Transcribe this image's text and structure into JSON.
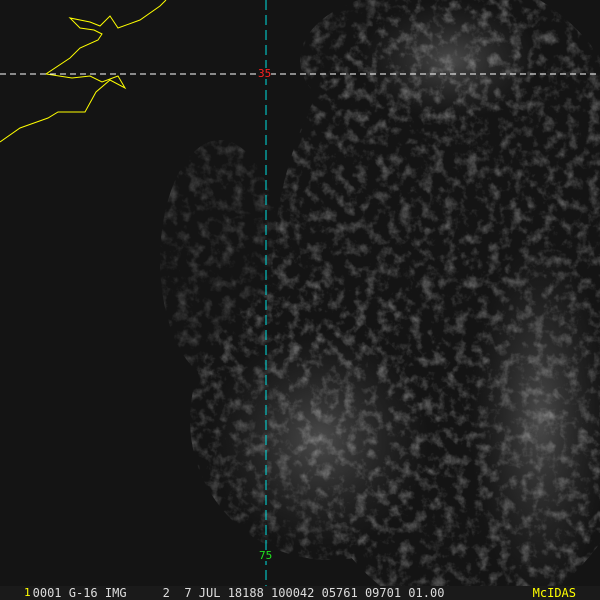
{
  "image": {
    "type": "satellite-visible",
    "grid_labels": {
      "latitude": "35",
      "longitude": "75"
    },
    "colors": {
      "coast": "#ffff00",
      "lat_line": "#ffffff",
      "lon_line": "#00e0e0",
      "lat_label": "#ff2020",
      "lon_label": "#20e020",
      "brand": "#ffff00"
    }
  },
  "status_bar": {
    "frame": "1",
    "info": "0001 G-16 IMG     2  7 JUL 18188 100042 05761 09701 01.00",
    "brand": "McIDAS"
  }
}
